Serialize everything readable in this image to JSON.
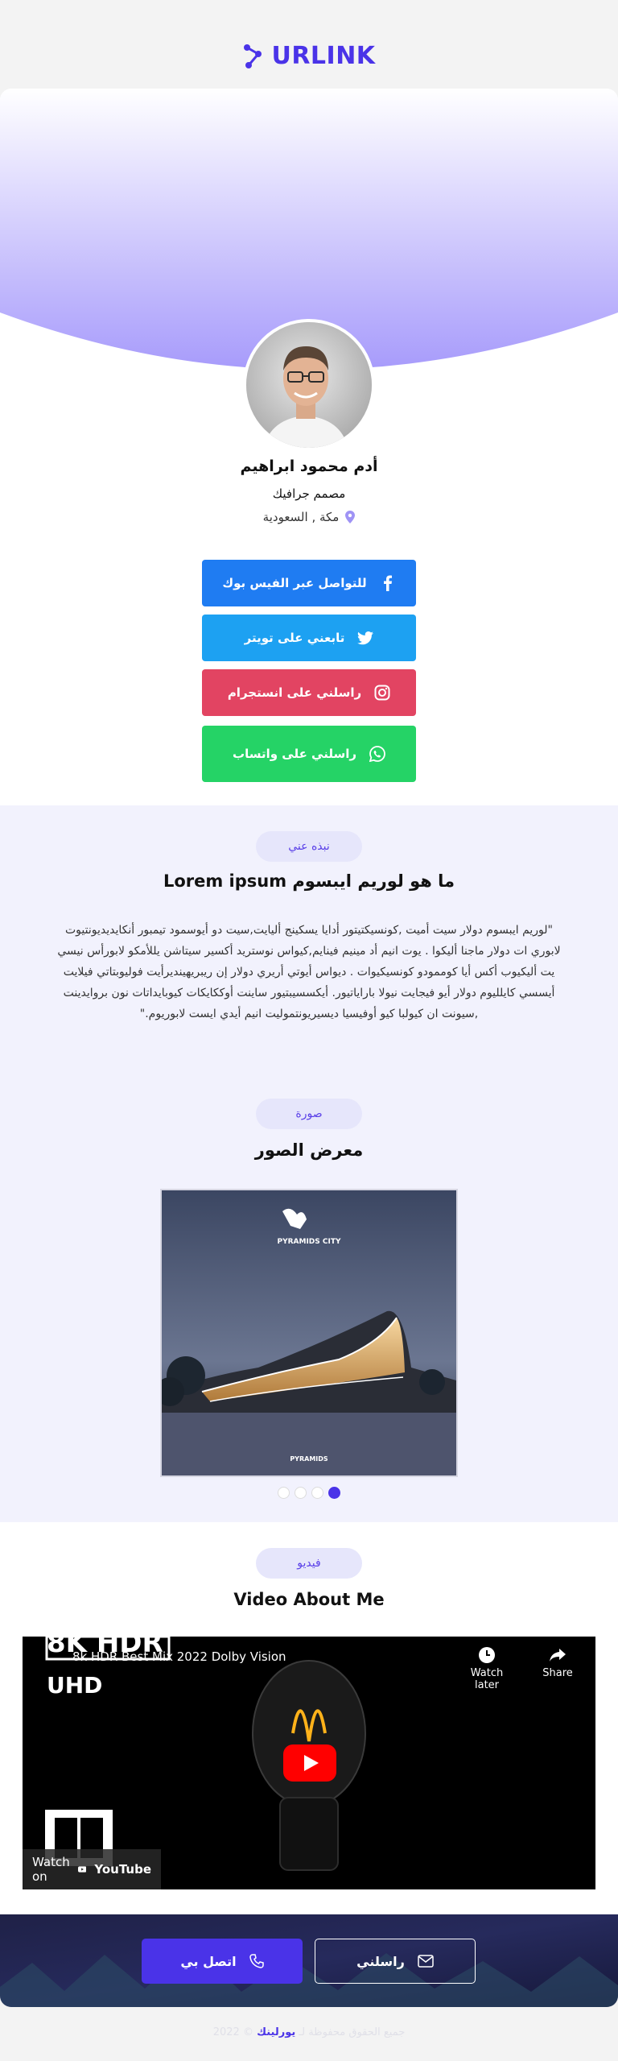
{
  "brand": {
    "name": "URLINK",
    "color": "#4a33e8"
  },
  "profile": {
    "name": "أدم محمود ابراهيم",
    "role": "مصمم جرافيك",
    "location": "مكة , السعودية"
  },
  "social_buttons": [
    {
      "label": "للتواصل عبر الفيس بوك",
      "icon": "facebook-icon",
      "color": "#1f7cf2"
    },
    {
      "label": "تابعني على تويتر",
      "icon": "twitter-icon",
      "color": "#1da1f2"
    },
    {
      "label": "راسلني على انستجرام",
      "icon": "instagram-icon",
      "color": "#e24462"
    },
    {
      "label": "راسلني على واتساب",
      "icon": "whatsapp-icon",
      "color": "#25d366"
    }
  ],
  "about": {
    "badge": "نبذه عني",
    "title": "ما هو لوريم ايبسوم Lorem ipsum",
    "text": "\"لوريم ايبسوم دولار سيت أميت ,كونسيكتيتور أدايا يسكينج أليايت,سيت دو أيوسمود تيمبور أنكايديديونتيوت لابوري ات دولار ماجنا أليكوا . يوت انيم أد مينيم فينايم,كيواس نوستريد أكسير سيتاشن يللأمكو لابورأس نيسي يت أليكيوب أكس أيا كوممودو كونسيكيوات . ديواس أيوتي أريري دولار إن ريبريهينديرأيت فوليوبتاتي فيلايت أيسسي كايلليوم دولار أيو فيجايت نيولا باراياتيور. أيكسسيبتيور ساينت أوككايكات كيوبايداتات نون بروايدينت ,سيونت ان كيولبا كيو أوفيسيا ديسيريونتموليت انيم أيدي ايست لابوريوم.\""
  },
  "gallery": {
    "badge": "صورة",
    "title": "معرض الصور",
    "image_caption_top": "PYRAMIDS CITY",
    "image_caption_bottom": "PYRAMIDS",
    "slides": 4,
    "active_slide": 4
  },
  "video": {
    "badge": "فيديو",
    "title": "Video About Me",
    "video_title": "8k HDR Best Mix 2022 Dolby Vision",
    "watch_later": "Watch later",
    "share": "Share",
    "watch_on": "Watch on",
    "youtube": "YouTube",
    "overlay_top": "8K HDR",
    "overlay_uhd": "UHD"
  },
  "cta": {
    "call_label": "اتصل بي",
    "message_label": "راسلني",
    "accent": "#4a33e8"
  },
  "footer": {
    "text_before": "جميع الحقوق محفوظة لـ",
    "brand": "يورلينك",
    "year": "© 2022"
  }
}
